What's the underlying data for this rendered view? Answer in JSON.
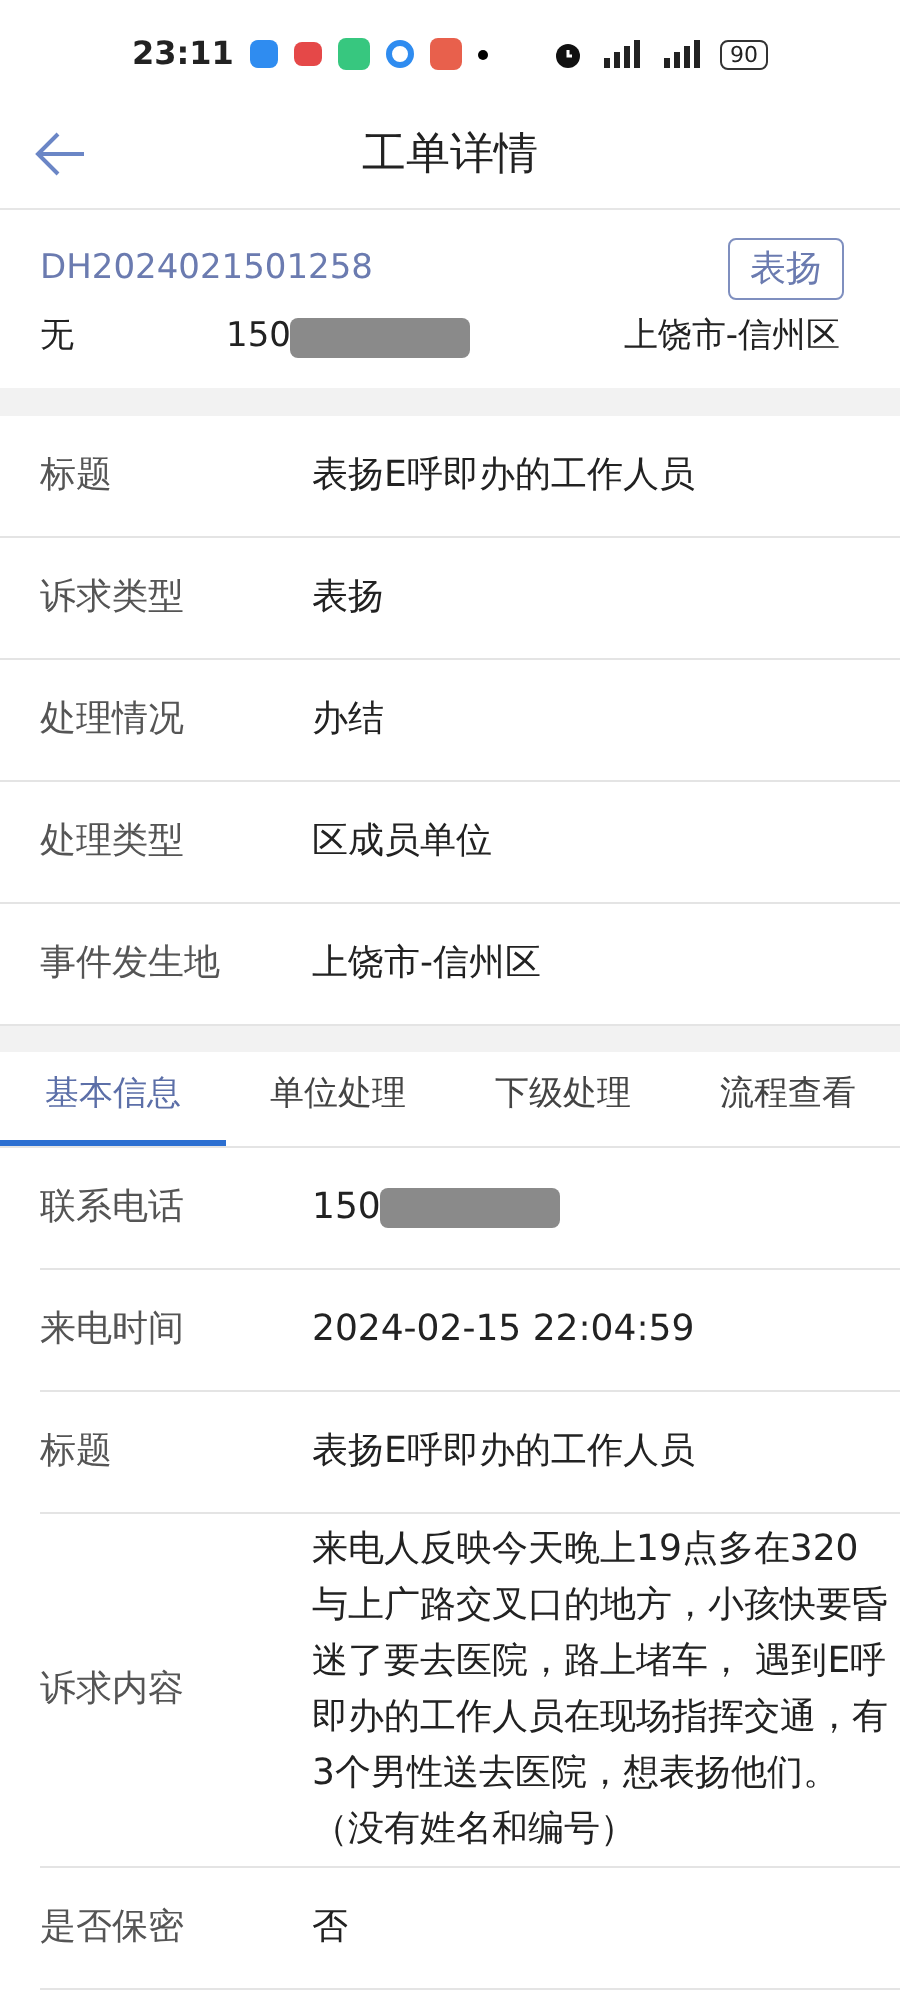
{
  "status_bar": {
    "time": "23:11",
    "battery": "90"
  },
  "header": {
    "title": "工单详情"
  },
  "summary": {
    "order_no": "DH2024021501258",
    "type_tag": "表扬",
    "name": "无",
    "phone": "150",
    "phone_redacted": true,
    "location": "上饶市-信州区"
  },
  "fields": [
    {
      "label": "标题",
      "value": "表扬E呼即办的工作人员"
    },
    {
      "label": "诉求类型",
      "value": "表扬"
    },
    {
      "label": "处理情况",
      "value": "办结"
    },
    {
      "label": "处理类型",
      "value": "区成员单位"
    },
    {
      "label": "事件发生地",
      "value": "上饶市-信州区"
    }
  ],
  "tabs": [
    {
      "label": "基本信息",
      "selected": true
    },
    {
      "label": "单位处理",
      "selected": false
    },
    {
      "label": "下级处理",
      "selected": false
    },
    {
      "label": "流程查看",
      "selected": false
    }
  ],
  "details": [
    {
      "label": "联系电话",
      "value": "150",
      "redacted": true
    },
    {
      "label": "来电时间",
      "value": "2024-02-15 22:04:59",
      "redacted": false
    },
    {
      "label": "标题",
      "value": "表扬E呼即办的工作人员",
      "redacted": false
    },
    {
      "label": "诉求内容",
      "value": "来电人反映今天晚上19点多在320与上广路交叉口的地方，小孩快要昏迷了要去医院，路上堵车， 遇到E呼即办的工作人员在现场指挥交通，有3个男性送去医院，想表扬他们。（没有姓名和编号）",
      "redacted": false
    },
    {
      "label": "是否保密",
      "value": "否",
      "redacted": false
    }
  ]
}
